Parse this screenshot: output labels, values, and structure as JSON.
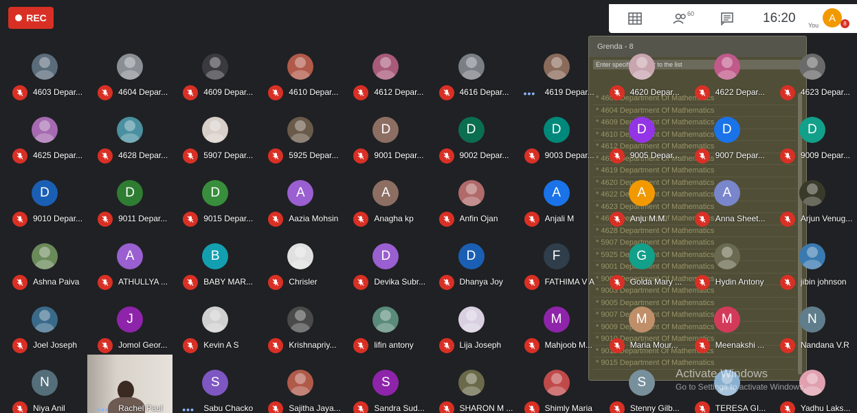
{
  "rec": {
    "label": "REC"
  },
  "topbar": {
    "people_count": "60",
    "clock": "16:20",
    "you_label": "You",
    "you_initial": "A",
    "notification_count": "8"
  },
  "overlay": {
    "title": "Grenda - 8",
    "search_text": "Enter specific number to the list",
    "items": [
      "* 4603 Department Of Mathematics",
      "* 4604 Department Of Mathematics",
      "* 4609 Department Of Mathematics",
      "* 4610 Department Of Mathematics",
      "* 4612 Department Of Mathematics",
      "* 4616 Department Of Mathematics",
      "* 4619 Department Of Mathematics",
      "* 4620 Department Of Mathematics",
      "* 4622 Department Of Mathematics",
      "* 4623 Department Of Mathematics",
      "* 4625 Department Of Mathematics",
      "* 4628 Department Of Mathematics",
      "* 5907 Department Of Mathematics",
      "* 5925 Department Of Mathematics",
      "* 9001 Department Of Mathematics",
      "* 9002 Department Of Mathematics",
      "* 9003 Department Of Mathematics",
      "* 9005 Department Of Mathematics",
      "* 9007 Department Of Mathematics",
      "* 9009 Department Of Mathematics",
      "* 9010 Department Of Mathematics",
      "* 9011 Department Of Mathematics",
      "* 9015 Department Of Mathematics"
    ]
  },
  "watermark": {
    "line1": "Activate Windows",
    "line2": "Go to Settings to activate Windows."
  },
  "participants": [
    {
      "name": "4603 Depar...",
      "initial": "",
      "color": "#5a6b7a",
      "photo": true
    },
    {
      "name": "4604 Depar...",
      "initial": "",
      "color": "#8a8f96",
      "photo": true
    },
    {
      "name": "4609 Depar...",
      "initial": "",
      "color": "#3a3a40",
      "photo": true
    },
    {
      "name": "4610 Depar...",
      "initial": "",
      "color": "#b05a4a",
      "photo": true
    },
    {
      "name": "4612 Depar...",
      "initial": "",
      "color": "#a85a7a",
      "photo": true
    },
    {
      "name": "4616 Depar...",
      "initial": "",
      "color": "#7a7f86",
      "photo": true
    },
    {
      "name": "4619 Depar...",
      "initial": "",
      "color": "#8a6a5a",
      "photo": true,
      "speaking": true
    },
    {
      "name": "4620 Depar...",
      "initial": "",
      "color": "#c9a5b0",
      "photo": true
    },
    {
      "name": "4622 Depar...",
      "initial": "",
      "color": "#c05a8a",
      "photo": true
    },
    {
      "name": "4623 Depar...",
      "initial": "",
      "color": "#6a6a6a",
      "photo": true
    },
    {
      "name": "4625 Depar...",
      "initial": "",
      "color": "#a56ab0",
      "photo": true
    },
    {
      "name": "4628 Depar...",
      "initial": "",
      "color": "#4a90a0",
      "photo": true
    },
    {
      "name": "5907 Depar...",
      "initial": "",
      "color": "#d8cfc8",
      "photo": true
    },
    {
      "name": "5925 Depar...",
      "initial": "",
      "color": "#6a5a4a",
      "photo": true
    },
    {
      "name": "9001 Depar...",
      "initial": "D",
      "color": "#8d6e63"
    },
    {
      "name": "9002 Depar...",
      "initial": "D",
      "color": "#0b6e4f"
    },
    {
      "name": "9003 Depar...",
      "initial": "D",
      "color": "#00897b"
    },
    {
      "name": "9005 Depar...",
      "initial": "D",
      "color": "#9334e6"
    },
    {
      "name": "9007 Depar...",
      "initial": "D",
      "color": "#1a73e8"
    },
    {
      "name": "9009 Depar...",
      "initial": "D",
      "color": "#12a08a"
    },
    {
      "name": "9010 Depar...",
      "initial": "D",
      "color": "#1a5fb4"
    },
    {
      "name": "9011 Depar...",
      "initial": "D",
      "color": "#2e7d32"
    },
    {
      "name": "9015 Depar...",
      "initial": "D",
      "color": "#388e3c"
    },
    {
      "name": "Aazia Mohsin",
      "initial": "A",
      "color": "#9a5fd0"
    },
    {
      "name": "Anagha kp",
      "initial": "A",
      "color": "#8d6e63"
    },
    {
      "name": "Anfin Ojan",
      "initial": "",
      "color": "#b06a6a",
      "photo": true
    },
    {
      "name": "Anjali M",
      "initial": "A",
      "color": "#1a73e8"
    },
    {
      "name": "Anju M.M.",
      "initial": "A",
      "color": "#f29900"
    },
    {
      "name": "Anna Sheet...",
      "initial": "A",
      "color": "#7986cb"
    },
    {
      "name": "Arjun Venug...",
      "initial": "",
      "color": "#3a3a2a",
      "photo": true
    },
    {
      "name": "Ashna Paiva",
      "initial": "",
      "color": "#6a8a5a",
      "photo": true
    },
    {
      "name": "ATHULLYA ...",
      "initial": "A",
      "color": "#9a5fd0"
    },
    {
      "name": "BABY MAR...",
      "initial": "B",
      "color": "#12a0b0"
    },
    {
      "name": "Chrisler",
      "initial": "",
      "color": "#e0e0e0",
      "photo": true
    },
    {
      "name": "Devika Subr...",
      "initial": "D",
      "color": "#9a5fd0"
    },
    {
      "name": "Dhanya Joy",
      "initial": "D",
      "color": "#1a5fb4"
    },
    {
      "name": "FATHIMA V A",
      "initial": "F",
      "color": "#2f3e4a"
    },
    {
      "name": "Golda Mary ...",
      "initial": "G",
      "color": "#12a08a"
    },
    {
      "name": "Hydin Antony",
      "initial": "",
      "color": "#6a6a50",
      "photo": true
    },
    {
      "name": "jibin johnson",
      "initial": "",
      "color": "#3a7ab0",
      "photo": true
    },
    {
      "name": "Joel Joseph",
      "initial": "",
      "color": "#3a6a8a",
      "photo": true
    },
    {
      "name": "Jomol Geor...",
      "initial": "J",
      "color": "#8e24aa"
    },
    {
      "name": "Kevin A S",
      "initial": "",
      "color": "#d0d0d0",
      "photo": true
    },
    {
      "name": "Krishnapriy...",
      "initial": "",
      "color": "#4a4a4a",
      "photo": true
    },
    {
      "name": "lifin antony",
      "initial": "",
      "color": "#5a8a7a",
      "photo": true
    },
    {
      "name": "Lija Joseph",
      "initial": "",
      "color": "#d8d0e0",
      "photo": true
    },
    {
      "name": "Mahjoob M...",
      "initial": "M",
      "color": "#8e24aa"
    },
    {
      "name": "Maria Mour...",
      "initial": "M",
      "color": "#bf8f6a"
    },
    {
      "name": "Meenakshi ...",
      "initial": "M",
      "color": "#d33a5a"
    },
    {
      "name": "Nandana V.R",
      "initial": "N",
      "color": "#607d8b"
    },
    {
      "name": "Niya Anil",
      "initial": "N",
      "color": "#546e7a"
    },
    {
      "name": "Rachel Paul",
      "initial": "",
      "color": "#c9c3bb",
      "video": true,
      "speaking": true
    },
    {
      "name": "Sabu Chacko",
      "initial": "S",
      "color": "#7e57c2",
      "speaking": true
    },
    {
      "name": "Sajitha Jaya...",
      "initial": "",
      "color": "#b05a4a",
      "photo": true
    },
    {
      "name": "Sandra Sud...",
      "initial": "S",
      "color": "#8e24aa"
    },
    {
      "name": "SHARON M ...",
      "initial": "",
      "color": "#6a6a4a",
      "photo": true
    },
    {
      "name": "Shimly Maria",
      "initial": "",
      "color": "#c04a4a",
      "photo": true
    },
    {
      "name": "Stenny Gilb...",
      "initial": "S",
      "color": "#78909c"
    },
    {
      "name": "TERESA GI...",
      "initial": "",
      "color": "#8ab0d0",
      "photo": true
    },
    {
      "name": "Yadhu Laks...",
      "initial": "",
      "color": "#e0a0b0",
      "photo": true
    }
  ]
}
